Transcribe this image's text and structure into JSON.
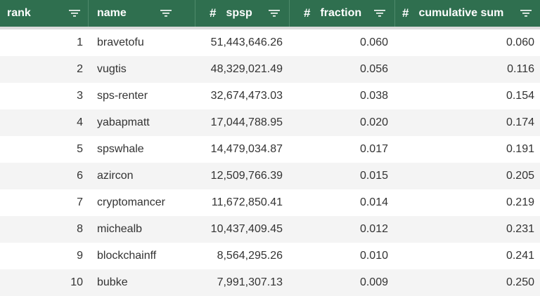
{
  "columns": [
    {
      "key": "rank",
      "label": "rank",
      "numeric": false
    },
    {
      "key": "name",
      "label": "name",
      "numeric": false
    },
    {
      "key": "spsp",
      "label": "spsp",
      "numeric": true,
      "type_glyph": "#"
    },
    {
      "key": "fraction",
      "label": "fraction",
      "numeric": true,
      "type_glyph": "#"
    },
    {
      "key": "cumsum",
      "label": "cumulative sum",
      "numeric": true,
      "type_glyph": "#"
    }
  ],
  "rows": [
    {
      "rank": "1",
      "name": "bravetofu",
      "spsp": "51,443,646.26",
      "fraction": "0.060",
      "cumsum": "0.060"
    },
    {
      "rank": "2",
      "name": "vugtis",
      "spsp": "48,329,021.49",
      "fraction": "0.056",
      "cumsum": "0.116"
    },
    {
      "rank": "3",
      "name": "sps-renter",
      "spsp": "32,674,473.03",
      "fraction": "0.038",
      "cumsum": "0.154"
    },
    {
      "rank": "4",
      "name": "yabapmatt",
      "spsp": "17,044,788.95",
      "fraction": "0.020",
      "cumsum": "0.174"
    },
    {
      "rank": "5",
      "name": "spswhale",
      "spsp": "14,479,034.87",
      "fraction": "0.017",
      "cumsum": "0.191"
    },
    {
      "rank": "6",
      "name": "azircon",
      "spsp": "12,509,766.39",
      "fraction": "0.015",
      "cumsum": "0.205"
    },
    {
      "rank": "7",
      "name": "cryptomancer",
      "spsp": "11,672,850.41",
      "fraction": "0.014",
      "cumsum": "0.219"
    },
    {
      "rank": "8",
      "name": "michealb",
      "spsp": "10,437,409.45",
      "fraction": "0.012",
      "cumsum": "0.231"
    },
    {
      "rank": "9",
      "name": "blockchainff",
      "spsp": "8,564,295.26",
      "fraction": "0.010",
      "cumsum": "0.241"
    },
    {
      "rank": "10",
      "name": "bubke",
      "spsp": "7,991,307.13",
      "fraction": "0.009",
      "cumsum": "0.250"
    }
  ],
  "icons": {
    "filter": "filter-icon"
  },
  "colors": {
    "header_bg": "#2f6f4f",
    "header_text": "#ffffff",
    "row_alt": "#f4f4f4",
    "text": "#333333"
  }
}
